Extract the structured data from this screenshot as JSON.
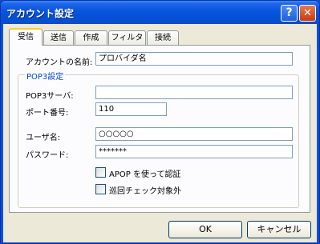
{
  "window": {
    "title": "アカウント設定",
    "help_label": "?",
    "close_label": "✕"
  },
  "tabs": [
    {
      "label": "受信",
      "active": true
    },
    {
      "label": "送信",
      "active": false
    },
    {
      "label": "作成",
      "active": false
    },
    {
      "label": "フィルタ",
      "active": false
    },
    {
      "label": "接続",
      "active": false
    }
  ],
  "account": {
    "name_label": "アカウントの名前:",
    "name_value": "プロバイダ名"
  },
  "pop3": {
    "group_title": "POP3設定",
    "server_label": "POP3サーバ:",
    "server_value": "",
    "port_label": "ポート番号:",
    "port_value": "110",
    "user_label": "ユーザ名:",
    "user_value": "○○○○○",
    "password_label": "パスワード:",
    "password_value": "*******",
    "apop_label": "APOP を使って認証",
    "apop_checked": false,
    "exclude_label": "巡回チェック対象外",
    "exclude_checked": false
  },
  "buttons": {
    "ok": "OK",
    "cancel": "キャンセル"
  }
}
